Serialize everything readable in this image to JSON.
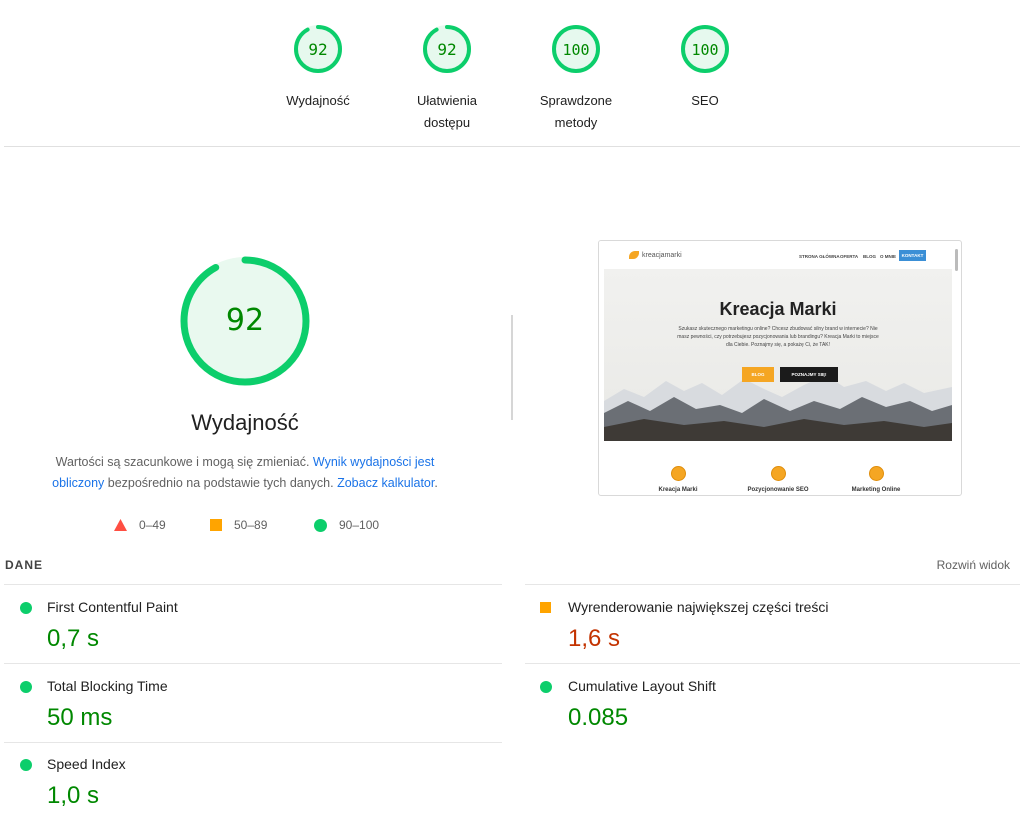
{
  "colors": {
    "pass": "#0cce6b",
    "pass_text": "#008800",
    "average": "#ffa400",
    "average_text": "#c33300",
    "fail": "#ff4e42",
    "link": "#1a73e8"
  },
  "categories": [
    {
      "score": 92,
      "label": "Wydajność"
    },
    {
      "score": 92,
      "label": "Ułatwienia dostępu"
    },
    {
      "score": 100,
      "label": "Sprawdzone metody"
    },
    {
      "score": 100,
      "label": "SEO"
    }
  ],
  "performance": {
    "score": 92,
    "title": "Wydajność",
    "desc_text1": "Wartości są szacunkowe i mogą się zmieniać. ",
    "desc_link1": "Wynik wydajności jest obliczony",
    "desc_text2": " bezpośrednio na podstawie tych danych. ",
    "desc_link2": "Zobacz kalkulator",
    "desc_text3": "."
  },
  "legend": [
    {
      "range": "0–49",
      "icon": "triangle-icon"
    },
    {
      "range": "50–89",
      "icon": "square-icon"
    },
    {
      "range": "90–100",
      "icon": "circle-icon"
    }
  ],
  "thumbnail": {
    "logo_text": "kreacjamarki",
    "menu": [
      "STRONA GŁÓWNA",
      "OFERTA",
      "BLOG",
      "O MNIE"
    ],
    "contact": "KONTAKT",
    "headline": "Kreacja Marki",
    "para": "Szukasz skutecznego marketingu online? Chcesz zbudować silny brand w internecie? Nie masz pewności, czy potrzebujesz pozycjonowania lub brandingu? Kreacja Marki to miejsce dla Ciebie. Poznajmy się, a pokażę Ci, że TAK!",
    "btn1": "BLOG",
    "btn2": "POZNAJMY SIĘ!",
    "features": [
      "Kreacja Marki",
      "Pozycjonowanie SEO",
      "Marketing Online"
    ]
  },
  "metrics_header": {
    "label": "DANE",
    "expand": "Rozwiń widok"
  },
  "metrics": {
    "fcp": {
      "name": "First Contentful Paint",
      "value": "0,7 s"
    },
    "lcp": {
      "name": "Wyrenderowanie największej części treści",
      "value": "1,6 s"
    },
    "tbt": {
      "name": "Total Blocking Time",
      "value": "50 ms"
    },
    "cls": {
      "name": "Cumulative Layout Shift",
      "value": "0.085"
    },
    "si": {
      "name": "Speed Index",
      "value": "1,0 s"
    }
  }
}
